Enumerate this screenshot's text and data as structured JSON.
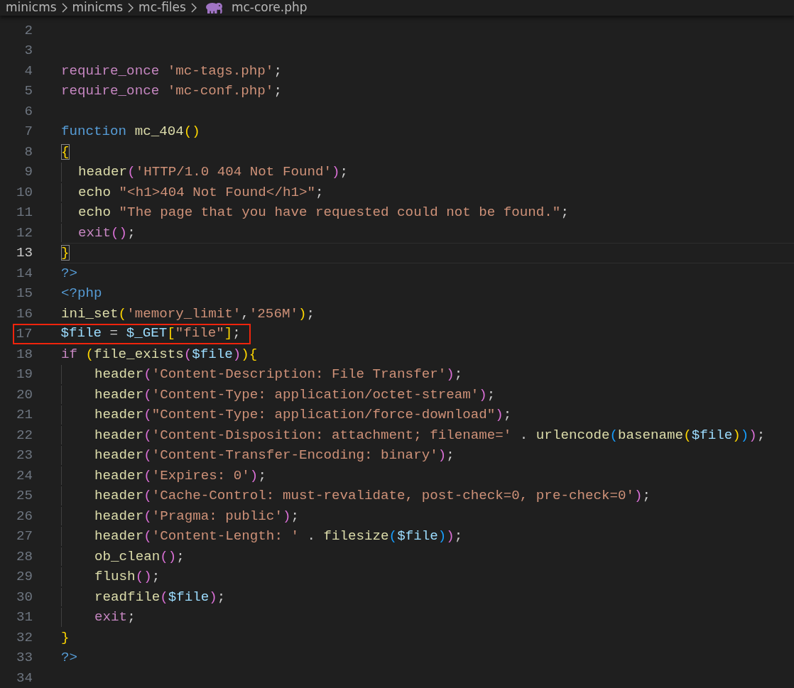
{
  "breadcrumb": [
    {
      "label": "minicms"
    },
    {
      "label": "minicms"
    },
    {
      "label": "mc-files"
    },
    {
      "label": "mc-core.php",
      "kind": "file"
    }
  ],
  "lines": [
    {
      "number": "2"
    },
    {
      "number": "3"
    },
    {
      "number": "4",
      "tokens": [
        {
          "kind": "control",
          "text": "require_once "
        },
        {
          "kind": "string",
          "text": "'mc-tags.php'"
        },
        {
          "kind": "plain",
          "text": ";"
        }
      ]
    },
    {
      "number": "5",
      "tokens": [
        {
          "kind": "control",
          "text": "require_once "
        },
        {
          "kind": "string",
          "text": "'mc-conf.php'"
        },
        {
          "kind": "plain",
          "text": ";"
        }
      ]
    },
    {
      "number": "6"
    },
    {
      "number": "7",
      "tokens": [
        {
          "kind": "keyword",
          "text": "function "
        },
        {
          "kind": "function",
          "text": "mc_404"
        },
        {
          "kind": "bracket",
          "text": "(",
          "color": "#ffd700"
        },
        {
          "kind": "bracket",
          "text": ")",
          "color": "#ffd700"
        }
      ]
    },
    {
      "number": "8",
      "tokens": [
        {
          "kind": "bracket",
          "text": "{",
          "color": "#ffd700",
          "matched": true
        }
      ]
    },
    {
      "number": "9",
      "tokens": [
        {
          "kind": "function",
          "text": "  header"
        },
        {
          "kind": "bracket",
          "text": "(",
          "color": "#da70d6"
        },
        {
          "kind": "string",
          "text": "'HTTP/1.0 404 Not Found'"
        },
        {
          "kind": "bracket",
          "text": ")",
          "color": "#da70d6"
        },
        {
          "kind": "plain",
          "text": ";"
        }
      ]
    },
    {
      "number": "10",
      "tokens": [
        {
          "kind": "function",
          "text": "  echo "
        },
        {
          "kind": "string",
          "text": "\"<h1>404 Not Found</h1>\""
        },
        {
          "kind": "plain",
          "text": ";"
        }
      ]
    },
    {
      "number": "11",
      "tokens": [
        {
          "kind": "function",
          "text": "  echo "
        },
        {
          "kind": "string",
          "text": "\"The page that you have requested could not be found.\""
        },
        {
          "kind": "plain",
          "text": ";"
        }
      ]
    },
    {
      "number": "12",
      "tokens": [
        {
          "kind": "control",
          "text": "  exit"
        },
        {
          "kind": "bracket",
          "text": "(",
          "color": "#da70d6"
        },
        {
          "kind": "bracket",
          "text": ")",
          "color": "#da70d6"
        },
        {
          "kind": "plain",
          "text": ";"
        }
      ]
    },
    {
      "number": "13",
      "current": true,
      "tokens": [
        {
          "kind": "bracket",
          "text": "}",
          "color": "#ffd700",
          "matched": true
        }
      ]
    },
    {
      "number": "14",
      "tokens": [
        {
          "kind": "keyword",
          "text": "?>"
        }
      ]
    },
    {
      "number": "15",
      "tokens": [
        {
          "kind": "keyword",
          "text": "<?php"
        }
      ]
    },
    {
      "number": "16",
      "tokens": [
        {
          "kind": "function",
          "text": "ini_set"
        },
        {
          "kind": "bracket",
          "text": "(",
          "color": "#ffd700"
        },
        {
          "kind": "string",
          "text": "'memory_limit'"
        },
        {
          "kind": "plain",
          "text": ","
        },
        {
          "kind": "string",
          "text": "'256M'"
        },
        {
          "kind": "bracket",
          "text": ")",
          "color": "#ffd700"
        },
        {
          "kind": "plain",
          "text": ";"
        }
      ]
    },
    {
      "number": "17",
      "annotated": true,
      "tokens": [
        {
          "kind": "variable",
          "text": "$file"
        },
        {
          "kind": "plain",
          "text": " = "
        },
        {
          "kind": "variable",
          "text": "$_GET"
        },
        {
          "kind": "bracket",
          "text": "[",
          "color": "#ffd700"
        },
        {
          "kind": "string",
          "text": "\"file\""
        },
        {
          "kind": "bracket",
          "text": "]",
          "color": "#ffd700"
        },
        {
          "kind": "plain",
          "text": ";"
        }
      ]
    },
    {
      "number": "18",
      "tokens": [
        {
          "kind": "control",
          "text": "if "
        },
        {
          "kind": "bracket",
          "text": "(",
          "color": "#ffd700"
        },
        {
          "kind": "function",
          "text": "file_exists"
        },
        {
          "kind": "bracket",
          "text": "(",
          "color": "#da70d6"
        },
        {
          "kind": "variable",
          "text": "$file"
        },
        {
          "kind": "bracket",
          "text": ")",
          "color": "#da70d6"
        },
        {
          "kind": "bracket",
          "text": ")",
          "color": "#ffd700"
        },
        {
          "kind": "bracket",
          "text": "{",
          "color": "#ffd700"
        }
      ]
    },
    {
      "number": "19",
      "tokens": [
        {
          "kind": "function",
          "text": "    header"
        },
        {
          "kind": "bracket",
          "text": "(",
          "color": "#da70d6"
        },
        {
          "kind": "string",
          "text": "'Content-Description: File Transfer'"
        },
        {
          "kind": "bracket",
          "text": ")",
          "color": "#da70d6"
        },
        {
          "kind": "plain",
          "text": ";"
        }
      ]
    },
    {
      "number": "20",
      "tokens": [
        {
          "kind": "function",
          "text": "    header"
        },
        {
          "kind": "bracket",
          "text": "(",
          "color": "#da70d6"
        },
        {
          "kind": "string",
          "text": "'Content-Type: application/octet-stream'"
        },
        {
          "kind": "bracket",
          "text": ")",
          "color": "#da70d6"
        },
        {
          "kind": "plain",
          "text": ";"
        }
      ]
    },
    {
      "number": "21",
      "tokens": [
        {
          "kind": "function",
          "text": "    header"
        },
        {
          "kind": "bracket",
          "text": "(",
          "color": "#da70d6"
        },
        {
          "kind": "string",
          "text": "\"Content-Type: application/force-download\""
        },
        {
          "kind": "bracket",
          "text": ")",
          "color": "#da70d6"
        },
        {
          "kind": "plain",
          "text": ";"
        }
      ]
    },
    {
      "number": "22",
      "tokens": [
        {
          "kind": "function",
          "text": "    header"
        },
        {
          "kind": "bracket",
          "text": "(",
          "color": "#da70d6"
        },
        {
          "kind": "string",
          "text": "'Content-Disposition: attachment; filename='"
        },
        {
          "kind": "plain",
          "text": " . "
        },
        {
          "kind": "function",
          "text": "urlencode"
        },
        {
          "kind": "bracket",
          "text": "(",
          "color": "#179fff"
        },
        {
          "kind": "function",
          "text": "basename"
        },
        {
          "kind": "bracket",
          "text": "(",
          "color": "#ffd700"
        },
        {
          "kind": "variable",
          "text": "$file"
        },
        {
          "kind": "bracket",
          "text": ")",
          "color": "#ffd700"
        },
        {
          "kind": "bracket",
          "text": ")",
          "color": "#179fff"
        },
        {
          "kind": "bracket",
          "text": ")",
          "color": "#da70d6"
        },
        {
          "kind": "plain",
          "text": ";"
        }
      ]
    },
    {
      "number": "23",
      "tokens": [
        {
          "kind": "function",
          "text": "    header"
        },
        {
          "kind": "bracket",
          "text": "(",
          "color": "#da70d6"
        },
        {
          "kind": "string",
          "text": "'Content-Transfer-Encoding: binary'"
        },
        {
          "kind": "bracket",
          "text": ")",
          "color": "#da70d6"
        },
        {
          "kind": "plain",
          "text": ";"
        }
      ]
    },
    {
      "number": "24",
      "tokens": [
        {
          "kind": "function",
          "text": "    header"
        },
        {
          "kind": "bracket",
          "text": "(",
          "color": "#da70d6"
        },
        {
          "kind": "string",
          "text": "'Expires: 0'"
        },
        {
          "kind": "bracket",
          "text": ")",
          "color": "#da70d6"
        },
        {
          "kind": "plain",
          "text": ";"
        }
      ]
    },
    {
      "number": "25",
      "tokens": [
        {
          "kind": "function",
          "text": "    header"
        },
        {
          "kind": "bracket",
          "text": "(",
          "color": "#da70d6"
        },
        {
          "kind": "string",
          "text": "'Cache-Control: must-revalidate, post-check=0, pre-check=0'"
        },
        {
          "kind": "bracket",
          "text": ")",
          "color": "#da70d6"
        },
        {
          "kind": "plain",
          "text": ";"
        }
      ]
    },
    {
      "number": "26",
      "tokens": [
        {
          "kind": "function",
          "text": "    header"
        },
        {
          "kind": "bracket",
          "text": "(",
          "color": "#da70d6"
        },
        {
          "kind": "string",
          "text": "'Pragma: public'"
        },
        {
          "kind": "bracket",
          "text": ")",
          "color": "#da70d6"
        },
        {
          "kind": "plain",
          "text": ";"
        }
      ]
    },
    {
      "number": "27",
      "tokens": [
        {
          "kind": "function",
          "text": "    header"
        },
        {
          "kind": "bracket",
          "text": "(",
          "color": "#da70d6"
        },
        {
          "kind": "string",
          "text": "'Content-Length: '"
        },
        {
          "kind": "plain",
          "text": " . "
        },
        {
          "kind": "function",
          "text": "filesize"
        },
        {
          "kind": "bracket",
          "text": "(",
          "color": "#179fff"
        },
        {
          "kind": "variable",
          "text": "$file"
        },
        {
          "kind": "bracket",
          "text": ")",
          "color": "#179fff"
        },
        {
          "kind": "bracket",
          "text": ")",
          "color": "#da70d6"
        },
        {
          "kind": "plain",
          "text": ";"
        }
      ]
    },
    {
      "number": "28",
      "tokens": [
        {
          "kind": "function",
          "text": "    ob_clean"
        },
        {
          "kind": "bracket",
          "text": "(",
          "color": "#da70d6"
        },
        {
          "kind": "bracket",
          "text": ")",
          "color": "#da70d6"
        },
        {
          "kind": "plain",
          "text": ";"
        }
      ]
    },
    {
      "number": "29",
      "tokens": [
        {
          "kind": "function",
          "text": "    flush"
        },
        {
          "kind": "bracket",
          "text": "(",
          "color": "#da70d6"
        },
        {
          "kind": "bracket",
          "text": ")",
          "color": "#da70d6"
        },
        {
          "kind": "plain",
          "text": ";"
        }
      ]
    },
    {
      "number": "30",
      "tokens": [
        {
          "kind": "function",
          "text": "    readfile"
        },
        {
          "kind": "bracket",
          "text": "(",
          "color": "#da70d6"
        },
        {
          "kind": "variable",
          "text": "$file"
        },
        {
          "kind": "bracket",
          "text": ")",
          "color": "#da70d6"
        },
        {
          "kind": "plain",
          "text": ";"
        }
      ]
    },
    {
      "number": "31",
      "tokens": [
        {
          "kind": "control",
          "text": "    exit"
        },
        {
          "kind": "plain",
          "text": ";"
        }
      ]
    },
    {
      "number": "32",
      "tokens": [
        {
          "kind": "bracket",
          "text": "}",
          "color": "#ffd700"
        }
      ]
    },
    {
      "number": "33",
      "tokens": [
        {
          "kind": "keyword",
          "text": "?>"
        }
      ]
    },
    {
      "number": "34"
    }
  ]
}
